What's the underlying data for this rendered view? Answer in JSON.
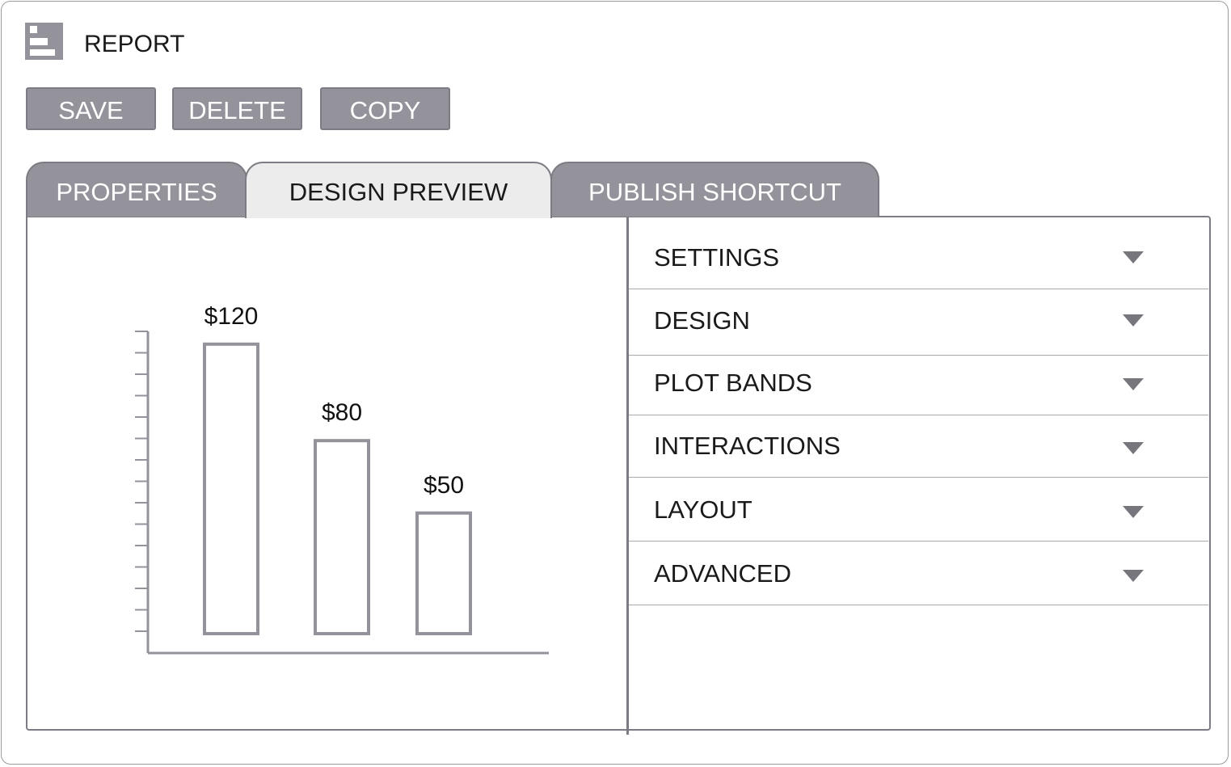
{
  "window": {
    "title": "REPORT",
    "icon": "report-icon"
  },
  "toolbar": {
    "save_label": "SAVE",
    "delete_label": "DELETE",
    "copy_label": "COPY"
  },
  "tabs": [
    {
      "label": "PROPERTIES",
      "active": false
    },
    {
      "label": "DESIGN PREVIEW",
      "active": true
    },
    {
      "label": "PUBLISH SHORTCUT",
      "active": false
    }
  ],
  "chart_data": {
    "type": "bar",
    "categories": [
      "",
      "",
      ""
    ],
    "values": [
      120,
      80,
      50
    ],
    "value_labels": [
      "$120",
      "$80",
      "$50"
    ],
    "title": "",
    "xlabel": "",
    "ylabel": "",
    "ylim": [
      0,
      140
    ],
    "y_tick_count": 15,
    "grid": false,
    "bar_fill": "#ffffff",
    "bar_stroke": "#94939b",
    "axis_color": "#94939b"
  },
  "accordion": {
    "items": [
      {
        "label": "SETTINGS",
        "icon": "chevron-down-icon"
      },
      {
        "label": "DESIGN",
        "icon": "chevron-down-icon"
      },
      {
        "label": "PLOT BANDS",
        "icon": "chevron-down-icon"
      },
      {
        "label": "INTERACTIONS",
        "icon": "chevron-down-icon"
      },
      {
        "label": "LAYOUT",
        "icon": "chevron-down-icon"
      },
      {
        "label": "ADVANCED",
        "icon": "chevron-down-icon"
      }
    ]
  },
  "colors": {
    "button_bg": "#94939b",
    "border": "#7d7c84",
    "active_tab_bg": "#ececec",
    "text": "#1a1a1a"
  }
}
